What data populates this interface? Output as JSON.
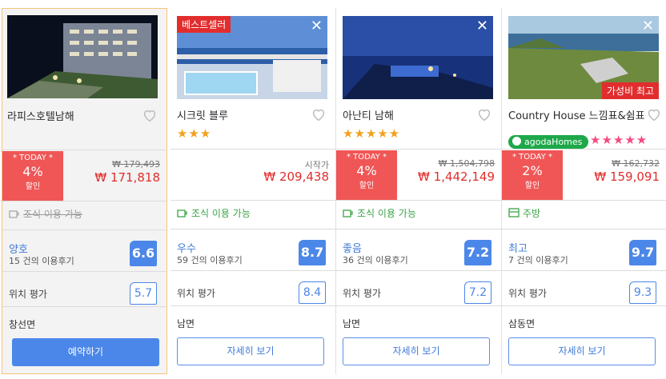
{
  "hotels": [
    {
      "name": "라피스호텔남해",
      "today_label": "* TODAY *",
      "discount": "4%",
      "discount_unit": "할인",
      "old_price": "₩ 179,493",
      "price": "₩ 171,818",
      "breakfast": "조식 이용 가능",
      "rating_label": "양호",
      "review_count": "15 건의 이용후기",
      "score": "6.6",
      "location_label": "위치 평가",
      "location_score": "5.7",
      "area": "창선면",
      "button": "예약하기"
    },
    {
      "name": "시크릿 블루",
      "badge": "베스트셀러",
      "stars": "★★★",
      "from_label": "시작가",
      "price": "₩ 209,438",
      "breakfast": "조식 이용 가능",
      "rating_label": "우수",
      "review_count": "59 건의 이용후기",
      "score": "8.7",
      "location_label": "위치 평가",
      "location_score": "8.4",
      "area": "남면",
      "button": "자세히 보기"
    },
    {
      "name": "아난티 남해",
      "stars": "★★★★★",
      "today_label": "* TODAY *",
      "discount": "4%",
      "discount_unit": "할인",
      "old_price": "₩ 1,504,798",
      "price": "₩ 1,442,149",
      "breakfast": "조식 이용 가능",
      "rating_label": "좋음",
      "review_count": "36 건의 이용후기",
      "score": "7.2",
      "location_label": "위치 평가",
      "location_score": "7.2",
      "area": "남면",
      "button": "자세히 보기"
    },
    {
      "name": "Country House 느낌표&쉼표",
      "badge_right": "가성비 최고",
      "brand": "agodaHomes",
      "stars": "★★★★★",
      "today_label": "* TODAY *",
      "discount": "2%",
      "discount_unit": "할인",
      "old_price": "₩ 162,732",
      "price": "₩ 159,091",
      "breakfast": "주방",
      "rating_label": "최고",
      "review_count": "7 건의 이용후기",
      "score": "9.7",
      "location_label": "위치 평가",
      "location_score": "9.3",
      "area": "삼동면",
      "button": "자세히 보기"
    }
  ],
  "colors": {
    "accent": "#4b87e8",
    "sale": "#e12d2d",
    "green": "#3aa345",
    "star": "#f2a11d"
  }
}
